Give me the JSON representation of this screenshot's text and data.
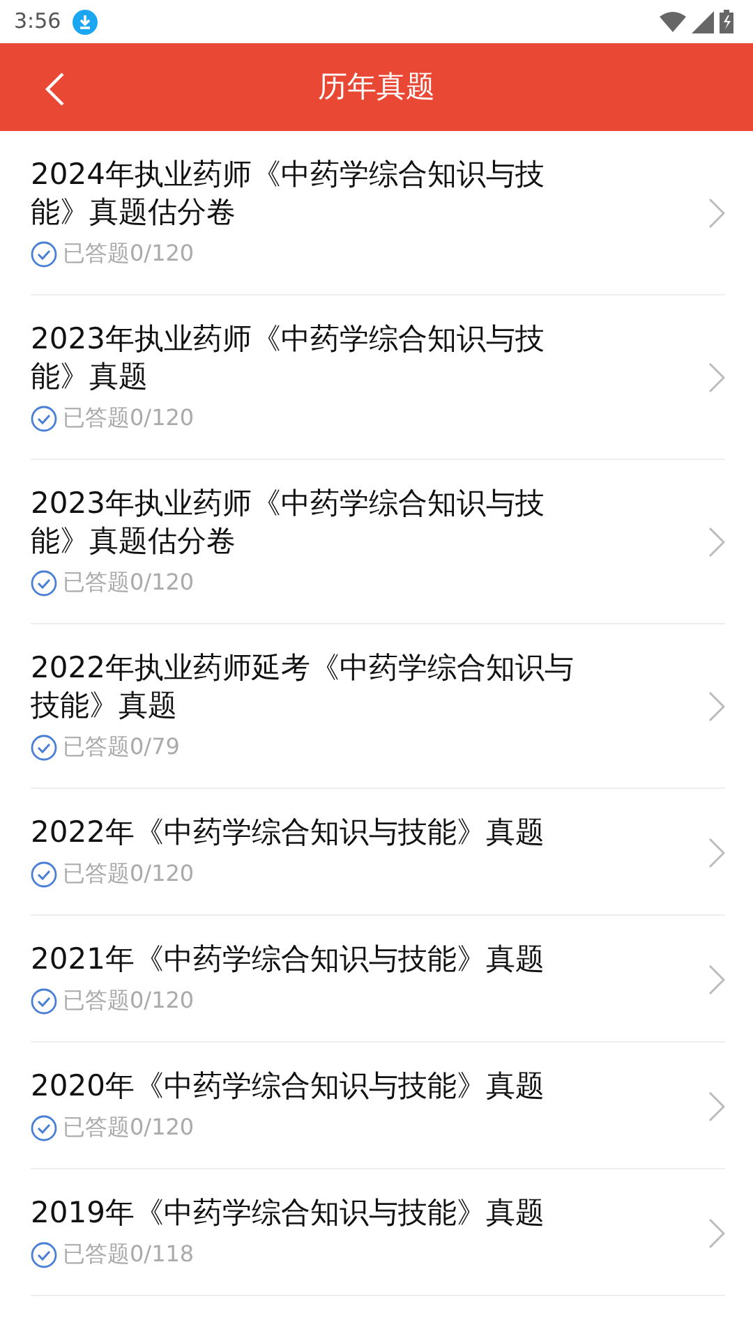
{
  "status_bar": {
    "time": "3:56"
  },
  "header": {
    "title": "历年真题"
  },
  "items": [
    {
      "title": "2024年执业药师《中药学综合知识与技能》真题估分卷",
      "progress": "已答题0/120"
    },
    {
      "title": "2023年执业药师《中药学综合知识与技能》真题",
      "progress": "已答题0/120"
    },
    {
      "title": "2023年执业药师《中药学综合知识与技能》真题估分卷",
      "progress": "已答题0/120"
    },
    {
      "title": "2022年执业药师延考《中药学综合知识与技能》真题",
      "progress": "已答题0/79"
    },
    {
      "title": "2022年《中药学综合知识与技能》真题",
      "progress": "已答题0/120"
    },
    {
      "title": "2021年《中药学综合知识与技能》真题",
      "progress": "已答题0/120"
    },
    {
      "title": "2020年《中药学综合知识与技能》真题",
      "progress": "已答题0/120"
    },
    {
      "title": "2019年《中药学综合知识与技能》真题",
      "progress": "已答题0/118"
    }
  ]
}
